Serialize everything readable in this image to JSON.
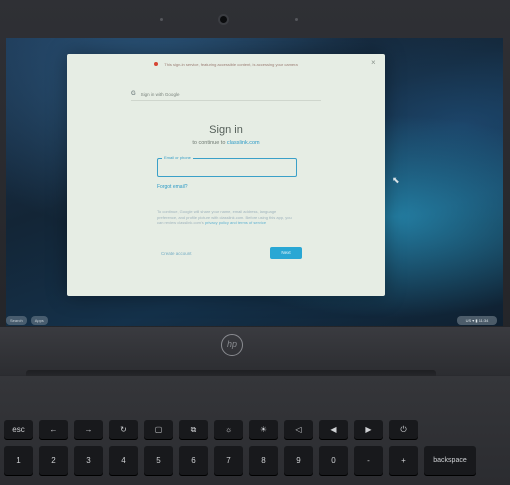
{
  "notice": {
    "text": "This sign-in service, featuring accessible content, is accessing your camera"
  },
  "google_bar": {
    "g": "G",
    "label": "Sign in with Google"
  },
  "dialog": {
    "title": "Sign in",
    "subtitle_prefix": "to continue to ",
    "subtitle_link": "classlink.com",
    "email_label": "Email or phone",
    "forgot": "Forgot email?",
    "info": "To continue, Google will share your name, email address, language preference, and profile picture with classlink.com. Before using this app, you can review classlink.com's",
    "info_link": "privacy policy and terms of service",
    "create": "Create account",
    "next": "Next"
  },
  "shelf": {
    "launcher": "Search",
    "apps": "Apps",
    "tray": "US  ▾ ▮ 11:34"
  },
  "brand": {
    "logo": "hp"
  },
  "keys_top": [
    "esc",
    "←",
    "→",
    "↻",
    "▢",
    "⧉",
    "☼",
    "☀",
    "◁",
    "◀",
    "▶",
    "⏻"
  ],
  "keys_num": [
    "!\n1",
    "@\n2",
    "#\n3",
    "$\n4",
    "%\n5",
    "^\n6",
    "&\n7",
    "*\n8",
    "(\n9",
    ")\n0",
    "-",
    "+",
    "backspace"
  ],
  "colors": {
    "accent": "#29a7d4",
    "record": "#d64533"
  }
}
